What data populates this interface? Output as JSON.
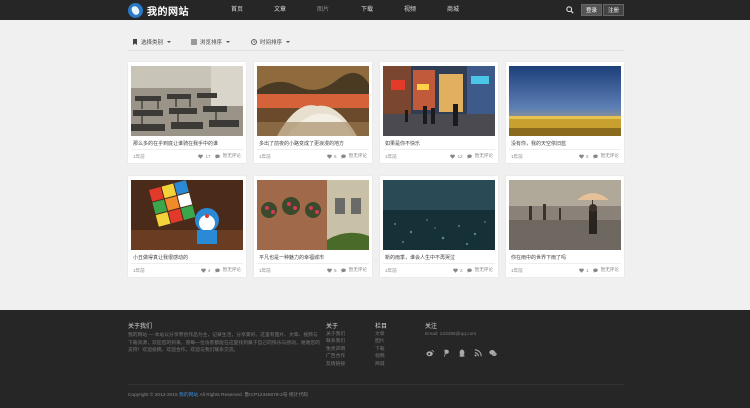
{
  "header": {
    "logo_text": "我的网站",
    "nav": [
      {
        "label": "首页"
      },
      {
        "label": "文章"
      },
      {
        "label": "图片"
      },
      {
        "label": "下载"
      },
      {
        "label": "视频"
      },
      {
        "label": "商城"
      }
    ],
    "active_nav": "图片",
    "login_label": "登录",
    "register_label": "注册"
  },
  "filters": [
    {
      "label": "选择类别",
      "icon": "bookmark-icon"
    },
    {
      "label": "浏览排序",
      "icon": "bars-icon"
    },
    {
      "label": "时间排序",
      "icon": "clock-icon"
    }
  ],
  "cards": [
    {
      "title": "那么多的在乎到底让谁骑在我手中的谁",
      "date": "1年前",
      "likes": "17",
      "comments": "暂无评论",
      "image": "classroom"
    },
    {
      "title": "多出了前夜的小路变成了更浪漫的地方",
      "date": "1年前",
      "likes": "6",
      "comments": "暂无评论",
      "image": "field"
    },
    {
      "title": "如果是你不快乐",
      "date": "1年前",
      "likes": "12",
      "comments": "暂无评论",
      "image": "street"
    },
    {
      "title": "没有你，我的天空依旧蓝",
      "date": "1年前",
      "likes": "5",
      "comments": "暂无评论",
      "image": "sunset"
    },
    {
      "title": "小丑做得真让我很感动的",
      "date": "1年前",
      "likes": "4",
      "comments": "暂无评论",
      "image": "cube"
    },
    {
      "title": "平凡也是一种魅力的幸福城市",
      "date": "1年前",
      "likes": "5",
      "comments": "暂无评论",
      "image": "house"
    },
    {
      "title": "新的雨季，谁会人生中不再哭泣",
      "date": "1年前",
      "likes": "2",
      "comments": "暂无评论",
      "image": "rain"
    },
    {
      "title": "你在雨中的世界下雨了吗",
      "date": "1年前",
      "likes": "1",
      "comments": "暂无评论",
      "image": "umbrella"
    }
  ],
  "footer": {
    "about_title": "关于我们",
    "about_text": "我的网站 — 本站以分享原创作品为主，记录生活，分享美好。这里有图片、文章、视频与下载资源，欢迎您的到来，愿每一位访客都能在这里找到属于自己的快乐与感动，谢谢您的支持！欢迎投稿，欢迎合作，欢迎与我们联系交流。",
    "col1_title": "关于",
    "col1_items": [
      "关于我们",
      "联系我们",
      "免责声明",
      "广告合作",
      "友情链接"
    ],
    "col2_title": "栏目",
    "col2_items": [
      "文章",
      "图片",
      "下载",
      "视频",
      "商城"
    ],
    "col3_title": "关注",
    "email": "Email: 123456@qq.com",
    "social_icons": [
      "weibo-icon",
      "pinterest-icon",
      "qq-icon",
      "rss-icon",
      "wechat-icon"
    ],
    "copyright_prefix": "Copyright © 2012-2015",
    "copyright_brand": "我的网站",
    "copyright_suffix": "All Rights Reserved. 鲁ICP12345678-2号 统计代码"
  }
}
